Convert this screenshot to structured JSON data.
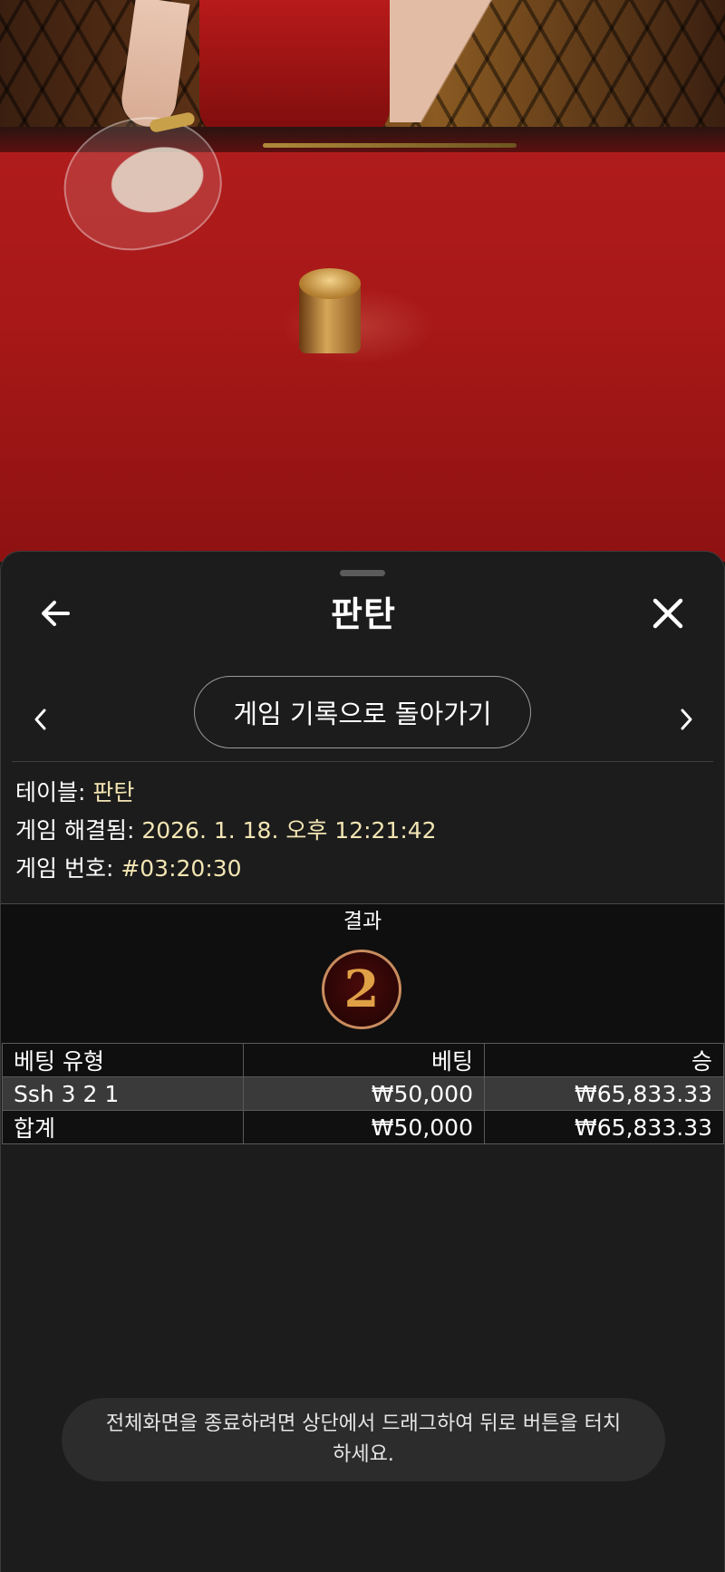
{
  "header": {
    "title": "판탄",
    "back_icon": "arrow-left-icon",
    "close_icon": "close-icon"
  },
  "navigation": {
    "prev_icon": "chevron-left-icon",
    "next_icon": "chevron-right-icon",
    "history_button_label": "게임 기록으로 돌아가기"
  },
  "game_info": {
    "table_label": "테이블:",
    "table_value": "판탄",
    "resolved_label": "게임 해결됨:",
    "resolved_value": "2026. 1. 18. 오후 12:21:42",
    "game_number_label": "게임 번호:",
    "game_number_value": "#03:20:30"
  },
  "result": {
    "header": "결과",
    "value": "2"
  },
  "bets_table": {
    "columns": [
      "베팅 유형",
      "베팅",
      "승"
    ],
    "rows": [
      {
        "type": "Ssh 3 2 1",
        "bet": "₩50,000",
        "win": "₩65,833.33"
      }
    ],
    "total": {
      "type": "합계",
      "bet": "₩50,000",
      "win": "₩65,833.33"
    }
  },
  "toast": {
    "message": "전체화면을 종료하려면 상단에서 드래그하여 뒤로 버튼을 터치하세요."
  },
  "colors": {
    "sheet_background": "#1c1c1c",
    "info_value": "#f3e5b3",
    "result_ball_border": "#c98c5e",
    "result_number": "#e0a046",
    "table_felt": "#a81818"
  }
}
